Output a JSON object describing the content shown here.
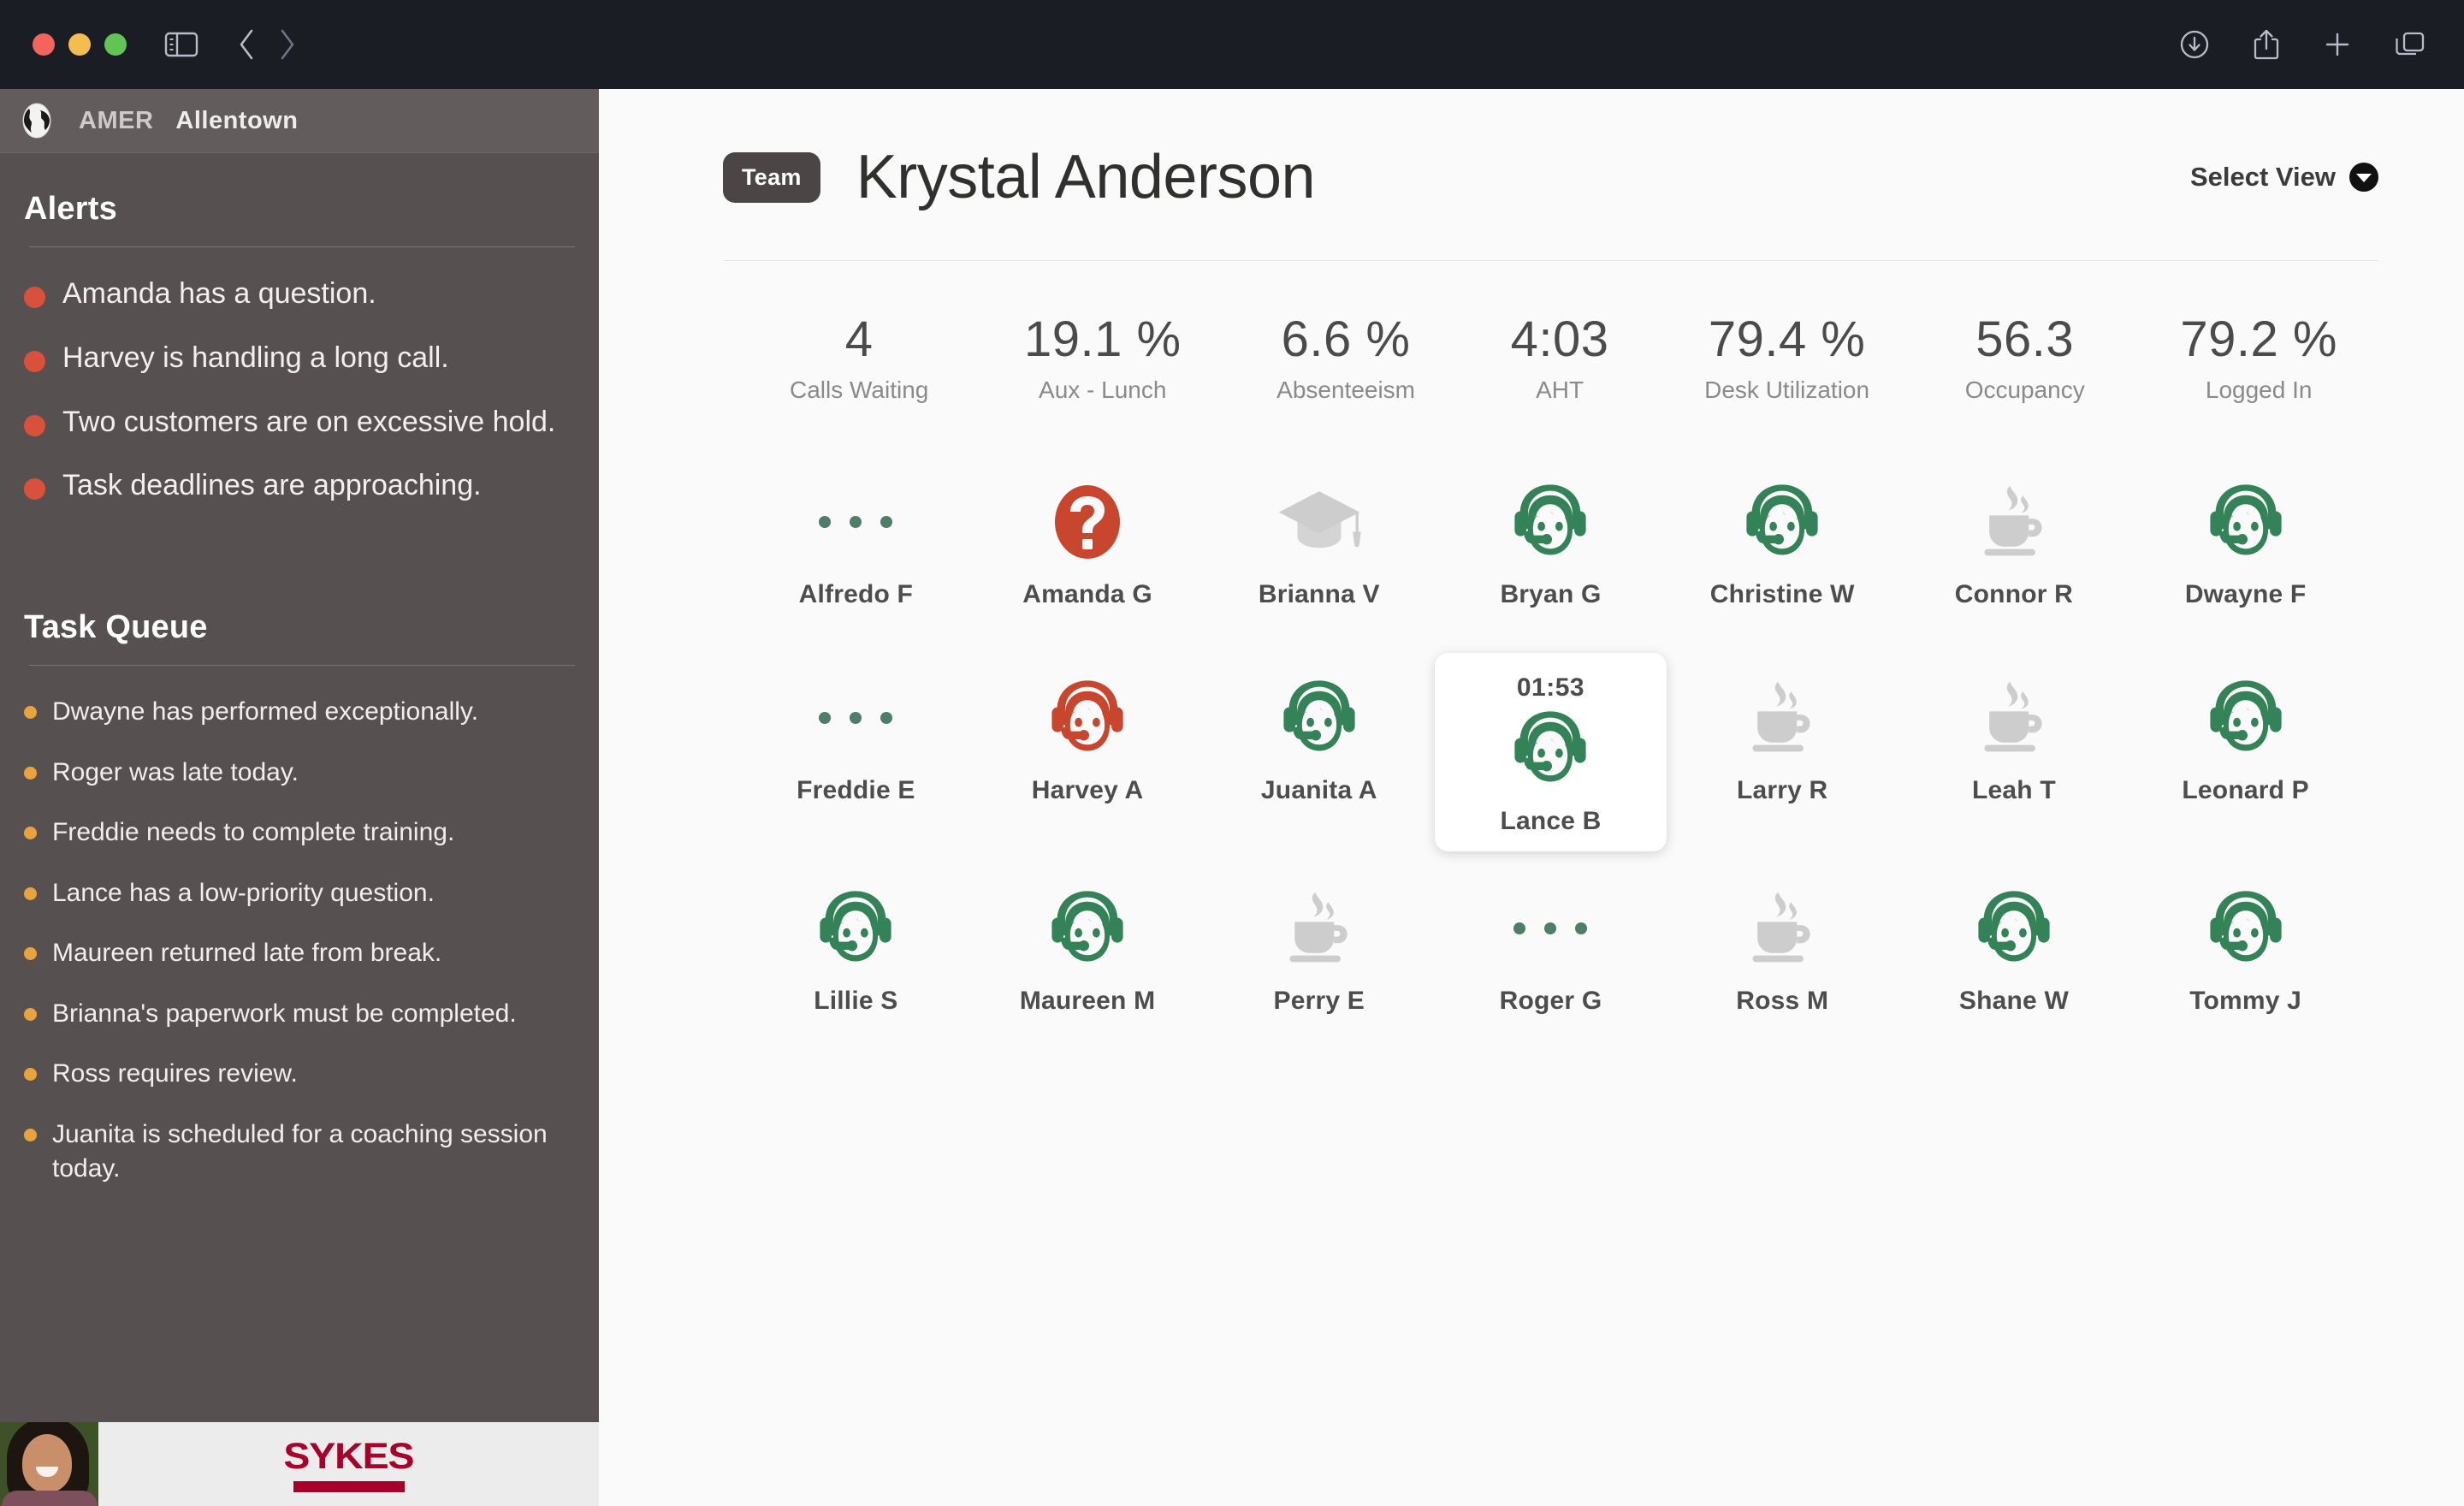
{
  "browser": {
    "window_controls": [
      "close",
      "minimize",
      "zoom"
    ],
    "left_icons": [
      "sidebar-toggle-icon",
      "back-arrow-icon",
      "forward-arrow-icon"
    ],
    "right_icons": [
      "downloads-icon",
      "share-icon",
      "new-tab-icon",
      "tab-overview-icon"
    ]
  },
  "sidebar": {
    "region": "AMER",
    "site": "Allentown",
    "alerts_title": "Alerts",
    "alerts": [
      "Amanda has a question.",
      "Harvey is handling a long call.",
      "Two customers are on excessive hold.",
      "Task deadlines are approaching."
    ],
    "task_queue_title": "Task Queue",
    "tasks": [
      "Dwayne has performed exceptionally.",
      "Roger was late today.",
      "Freddie needs to complete training.",
      "Lance has a low-priority question.",
      "Maureen returned late from break.",
      "Brianna's paperwork must be completed.",
      "Ross requires review.",
      "Juanita is scheduled for a coaching session today."
    ],
    "footer": {
      "logo_text": "SYKES",
      "logo_registered": "®"
    },
    "colors": {
      "background": "#575050",
      "alert_bullet": "#d9513a",
      "task_bullet": "#e8a33d",
      "logo": "#a8002a"
    }
  },
  "main": {
    "team_badge": "Team",
    "team_name": "Krystal Anderson",
    "select_view_label": "Select View",
    "kpis": [
      {
        "value": "4",
        "label": "Calls Waiting"
      },
      {
        "value": "19.1 %",
        "label": "Aux - Lunch"
      },
      {
        "value": "6.6 %",
        "label": "Absenteeism"
      },
      {
        "value": "4:03",
        "label": "AHT"
      },
      {
        "value": "79.4 %",
        "label": "Desk Utilization"
      },
      {
        "value": "56.3",
        "label": "Occupancy"
      },
      {
        "value": "79.2 %",
        "label": "Logged In"
      }
    ],
    "agents": [
      {
        "name": "Alfredo F",
        "status": "offline",
        "icon": "dots-icon",
        "timer": "",
        "selected": false
      },
      {
        "name": "Amanda G",
        "status": "question",
        "icon": "question-icon",
        "timer": "",
        "selected": false
      },
      {
        "name": "Brianna V",
        "status": "training",
        "icon": "graduation-cap-icon",
        "timer": "",
        "selected": false
      },
      {
        "name": "Bryan G",
        "status": "available",
        "icon": "headset-icon",
        "timer": "",
        "selected": false
      },
      {
        "name": "Christine W",
        "status": "available",
        "icon": "headset-icon",
        "timer": "",
        "selected": false
      },
      {
        "name": "Connor R",
        "status": "break",
        "icon": "coffee-cup-icon",
        "timer": "",
        "selected": false
      },
      {
        "name": "Dwayne F",
        "status": "available",
        "icon": "headset-icon",
        "timer": "",
        "selected": false
      },
      {
        "name": "Freddie E",
        "status": "offline",
        "icon": "dots-icon",
        "timer": "",
        "selected": false
      },
      {
        "name": "Harvey A",
        "status": "long-call",
        "icon": "headset-icon",
        "timer": "",
        "selected": false
      },
      {
        "name": "Juanita A",
        "status": "available",
        "icon": "headset-icon",
        "timer": "",
        "selected": false
      },
      {
        "name": "Lance B",
        "status": "available",
        "icon": "headset-icon",
        "timer": "01:53",
        "selected": true
      },
      {
        "name": "Larry R",
        "status": "break",
        "icon": "coffee-cup-icon",
        "timer": "",
        "selected": false
      },
      {
        "name": "Leah T",
        "status": "break",
        "icon": "coffee-cup-icon",
        "timer": "",
        "selected": false
      },
      {
        "name": "Leonard P",
        "status": "available",
        "icon": "headset-icon",
        "timer": "",
        "selected": false
      },
      {
        "name": "Lillie S",
        "status": "available",
        "icon": "headset-icon",
        "timer": "",
        "selected": false
      },
      {
        "name": "Maureen M",
        "status": "available",
        "icon": "headset-icon",
        "timer": "",
        "selected": false
      },
      {
        "name": "Perry E",
        "status": "break",
        "icon": "coffee-cup-icon",
        "timer": "",
        "selected": false
      },
      {
        "name": "Roger G",
        "status": "offline",
        "icon": "dots-icon",
        "timer": "",
        "selected": false
      },
      {
        "name": "Ross M",
        "status": "break",
        "icon": "coffee-cup-icon",
        "timer": "",
        "selected": false
      },
      {
        "name": "Shane W",
        "status": "available",
        "icon": "headset-icon",
        "timer": "",
        "selected": false
      },
      {
        "name": "Tommy J",
        "status": "available",
        "icon": "headset-icon",
        "timer": "",
        "selected": false
      }
    ],
    "colors": {
      "available": "#348257",
      "alert": "#c8462e",
      "inactive": "#cdcdcd",
      "background": "#fafafa"
    }
  }
}
